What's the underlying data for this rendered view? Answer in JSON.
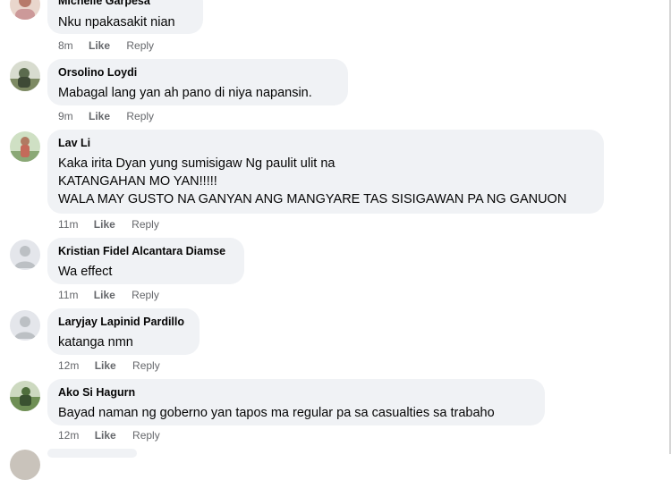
{
  "comments": [
    {
      "name": "Michelle Garpesa",
      "text": [
        "Nku npakasakit nian"
      ],
      "time": "8m",
      "like": "Like",
      "reply": "Reply",
      "avatar_icon": "user-photo-icon",
      "avatar_color": "#b77a6a"
    },
    {
      "name": "Orsolino Loydi",
      "text": [
        "Mabagal lang yan ah pano di niya napansin."
      ],
      "time": "9m",
      "like": "Like",
      "reply": "Reply",
      "avatar_icon": "user-photo-icon",
      "avatar_color": "#5b6b4e"
    },
    {
      "name": "Lav Li",
      "text": [
        "Kaka irita Dyan yung sumisigaw Ng paulit ulit na",
        "KATANGAHAN MO YAN!!!!!",
        "WALA MAY GUSTO NA GANYAN ANG MANGYARE TAS SISIGAWAN PA NG GANUON"
      ],
      "time": "11m",
      "like": "Like",
      "reply": "Reply",
      "avatar_icon": "user-photo-icon",
      "avatar_color": "#7a9a6a"
    },
    {
      "name": "Kristian Fidel Alcantara Diamse",
      "text": [
        "Wa effect"
      ],
      "time": "11m",
      "like": "Like",
      "reply": "Reply",
      "avatar_icon": "default-avatar-icon",
      "avatar_color": "#bcc0c4"
    },
    {
      "name": "Laryjay Lapinid Pardillo",
      "text": [
        "katanga nmn"
      ],
      "time": "12m",
      "like": "Like",
      "reply": "Reply",
      "avatar_icon": "default-avatar-icon",
      "avatar_color": "#bcc0c4"
    },
    {
      "name": "Ako Si Hagurn",
      "text": [
        "Bayad naman ng goberno yan tapos ma regular pa sa casualties sa trabaho"
      ],
      "time": "12m",
      "like": "Like",
      "reply": "Reply",
      "avatar_icon": "user-photo-icon",
      "avatar_color": "#4f6e3c"
    }
  ],
  "colors": {
    "bubble": "#f0f2f5",
    "meta_text": "#65676b",
    "name_text": "#050505"
  }
}
